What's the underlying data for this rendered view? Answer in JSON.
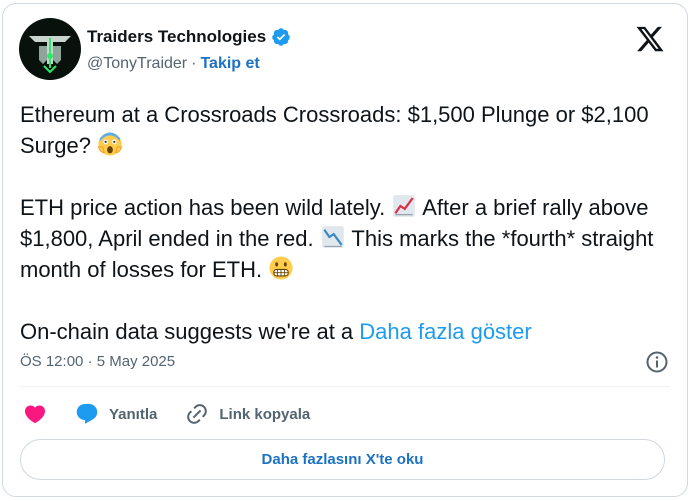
{
  "author": {
    "name": "Traiders Technologies",
    "handle": "@TonyTraider",
    "separator": "·",
    "follow_label": "Takip et",
    "verified_color": "#1d9bf0"
  },
  "tweet": {
    "line1": "Ethereum at a Crossroads  Crossroads: $1,500 Plunge or $2,100 Surge?",
    "p2_a": "ETH price action has been wild lately.",
    "p2_b": "After a brief rally above $1,800, April ended in the red.",
    "p2_c": "This marks the *fourth* straight month of losses for ETH.",
    "p3": "On-chain data suggests we're at a",
    "show_more": "Daha fazla göster"
  },
  "meta": {
    "time": "ÖS 12:00",
    "dot": "·",
    "date": "5 May 2025"
  },
  "actions": {
    "reply_label": "Yanıtla",
    "copy_link_label": "Link kopyala"
  },
  "read_more_label": "Daha fazlasını X'te oku",
  "icons": [
    "verified-badge-icon",
    "x-logo-icon",
    "screaming-emoji-icon",
    "chart-up-emoji-icon",
    "chart-down-emoji-icon",
    "grimacing-emoji-icon",
    "info-icon",
    "heart-icon",
    "reply-bubble-icon",
    "link-icon"
  ],
  "colors": {
    "accent": "#1d9bf0",
    "link_dark": "#1d72c4",
    "heart": "#f91880",
    "text_secondary": "#536471"
  }
}
